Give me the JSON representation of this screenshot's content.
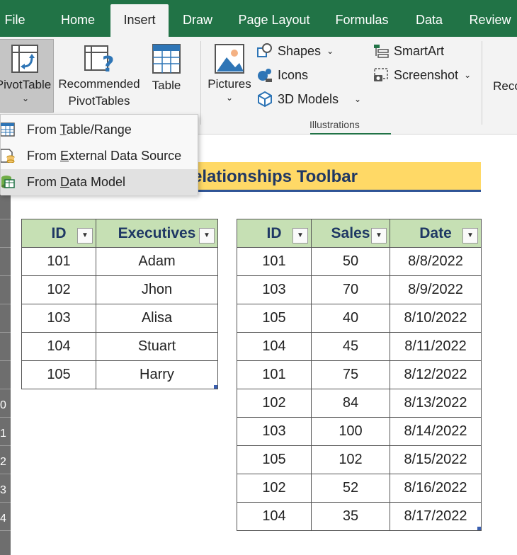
{
  "tabs": [
    {
      "label": "File"
    },
    {
      "label": "Home"
    },
    {
      "label": "Insert",
      "active": true
    },
    {
      "label": "Draw"
    },
    {
      "label": "Page Layout"
    },
    {
      "label": "Formulas"
    },
    {
      "label": "Data"
    },
    {
      "label": "Review"
    }
  ],
  "ribbon": {
    "pivottable": "PivotTable",
    "recommended_line1": "Recommended",
    "recommended_line2": "PivotTables",
    "table": "Table",
    "pictures": "Pictures",
    "shapes": "Shapes",
    "icons": "Icons",
    "models3d": "3D Models",
    "smartart": "SmartArt",
    "screenshot": "Screenshot",
    "illustrations_group": "Illustrations",
    "rec_partial": "Reco"
  },
  "menu": {
    "items": [
      {
        "before": "From ",
        "accel": "T",
        "after": "able/Range"
      },
      {
        "before": "From ",
        "accel": "E",
        "after": "xternal Data Source"
      },
      {
        "before": "From ",
        "accel": "D",
        "after": "ata Model"
      }
    ]
  },
  "sheet": {
    "title_partial": "elationships Toolbar",
    "row_numbers_partial": [
      "0",
      "1",
      "2",
      "3",
      "4"
    ],
    "table1": {
      "headers": [
        "ID",
        "Executives"
      ],
      "rows": [
        [
          "101",
          "Adam"
        ],
        [
          "102",
          "Jhon"
        ],
        [
          "103",
          "Alisa"
        ],
        [
          "104",
          "Stuart"
        ],
        [
          "105",
          "Harry"
        ]
      ]
    },
    "table2": {
      "headers": [
        "ID",
        "Sales",
        "Date"
      ],
      "rows": [
        [
          "101",
          "50",
          "8/8/2022"
        ],
        [
          "103",
          "70",
          "8/9/2022"
        ],
        [
          "105",
          "40",
          "8/10/2022"
        ],
        [
          "104",
          "45",
          "8/11/2022"
        ],
        [
          "101",
          "75",
          "8/12/2022"
        ],
        [
          "102",
          "84",
          "8/13/2022"
        ],
        [
          "103",
          "100",
          "8/14/2022"
        ],
        [
          "105",
          "102",
          "8/15/2022"
        ],
        [
          "102",
          "52",
          "8/16/2022"
        ],
        [
          "104",
          "35",
          "8/17/2022"
        ]
      ]
    }
  },
  "colors": {
    "tab_bar": "#217346",
    "header_fill": "#c6e0b4",
    "title_fill": "#ffd966",
    "title_text": "#203864"
  }
}
